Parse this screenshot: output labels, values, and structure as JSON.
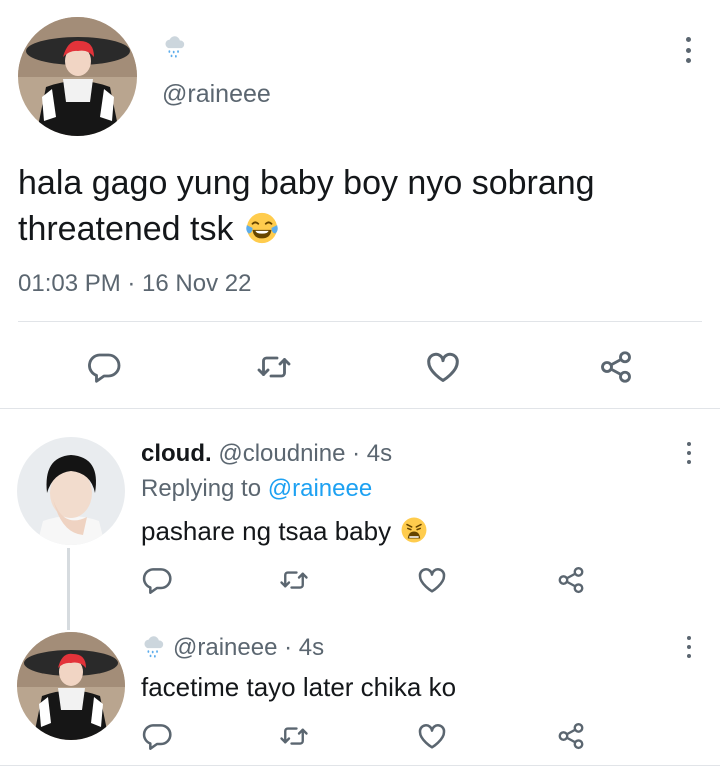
{
  "colors": {
    "text": "#14171a",
    "muted": "#5b6670",
    "link": "#1da1f2",
    "divider": "#e1e4e8",
    "icon": "#5b6670"
  },
  "main_tweet": {
    "display_name_icon": "rain-cloud-emoji",
    "handle": "@raineee",
    "text": "hala gago yung baby boy nyo sobrang threatened tsk",
    "emoji": "face-with-tears-of-joy-emoji",
    "timestamp": "01:03 PM · 16 Nov 22",
    "actions": [
      "reply-icon",
      "retweet-icon",
      "like-icon",
      "share-icon"
    ]
  },
  "replies": [
    {
      "display_name": "cloud.",
      "handle_time": "@cloudnine · 4s",
      "replying_label": "Replying to ",
      "replying_handle": "@raineee",
      "text": "pashare ng tsaa baby",
      "emoji": "weary-face-emoji"
    },
    {
      "display_name_icon": "rain-cloud-emoji",
      "handle_time": "@raineee · 4s",
      "text": "facetime tayo later chika ko"
    }
  ]
}
